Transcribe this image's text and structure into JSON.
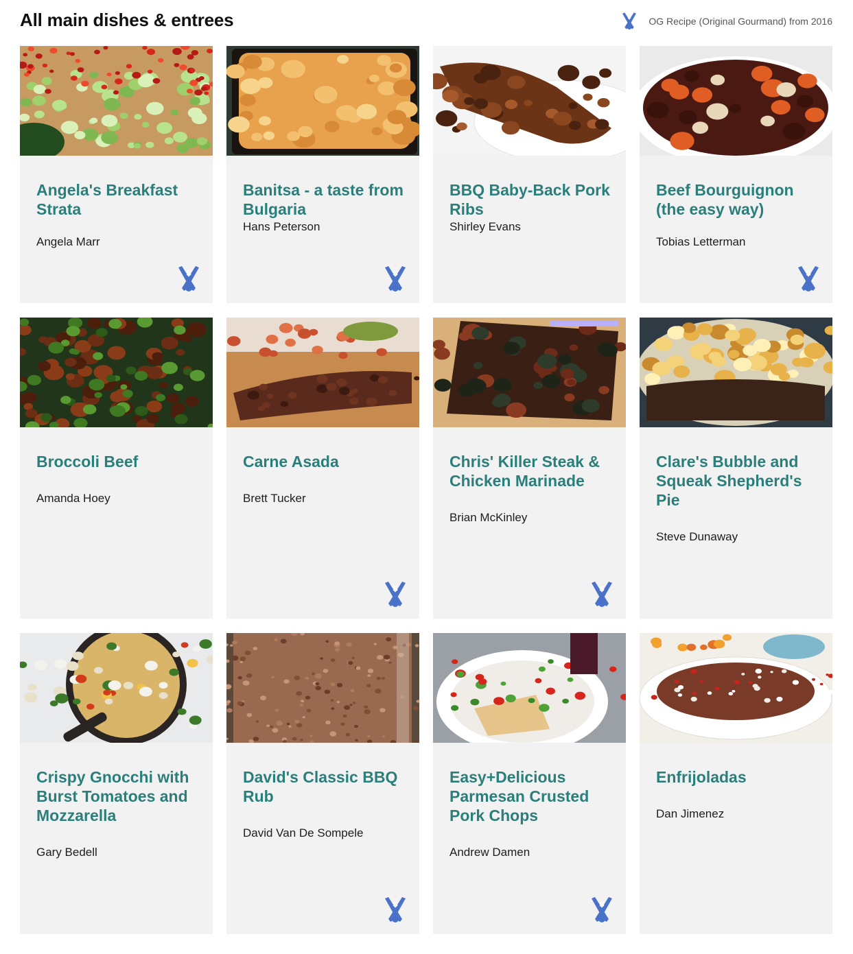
{
  "page": {
    "title": "All main dishes & entrees",
    "legend_text": "OG Recipe (Original Gourmand) from 2016",
    "legend_icon": "og-recipe-badge-icon",
    "accent_color": "#2a7f7b",
    "badge_color": "#4a72c9"
  },
  "recipes": [
    {
      "title": "Angela's Breakfast Strata",
      "author": "Angela Marr",
      "og": true,
      "image": "chopped-leeks-peppers-photo"
    },
    {
      "title": "Banitsa - a taste from Bulgaria",
      "author": "Hans Peterson",
      "og": true,
      "image": "banitsa-pastry-photo"
    },
    {
      "title": "BBQ Baby-Back Pork Ribs",
      "author": "Shirley Evans",
      "og": false,
      "image": "pork-ribs-photo"
    },
    {
      "title": "Beef Bourguignon (the easy way)",
      "author": "Tobias Letterman",
      "og": true,
      "image": "beef-stew-photo"
    },
    {
      "title": "Broccoli Beef",
      "author": "Amanda Hoey",
      "og": false,
      "image": "broccoli-beef-photo"
    },
    {
      "title": "Carne Asada",
      "author": "Brett Tucker",
      "og": true,
      "image": "grilled-steak-photo"
    },
    {
      "title": "Chris' Killer Steak & Chicken Marinade",
      "author": "Brian McKinley",
      "og": true,
      "image": "marinade-bag-photo"
    },
    {
      "title": "Clare's Bubble and Squeak Shepherd's Pie",
      "author": "Steve Dunaway",
      "og": false,
      "image": "shepherds-pie-photo"
    },
    {
      "title": "Crispy Gnocchi with Burst Tomatoes and Mozzarella",
      "author": "Gary Bedell",
      "og": false,
      "image": "gnocchi-skillet-photo"
    },
    {
      "title": "David's Classic BBQ Rub",
      "author": "David Van De Sompele",
      "og": true,
      "image": "bbq-rub-jar-photo"
    },
    {
      "title": "Easy+Delicious Parmesan Crusted Pork Chops",
      "author": "Andrew Damen",
      "og": true,
      "image": "pork-chops-plate-photo"
    },
    {
      "title": "Enfrijoladas",
      "author": "Dan Jimenez",
      "og": false,
      "image": "enfrijoladas-plate-photo"
    }
  ]
}
